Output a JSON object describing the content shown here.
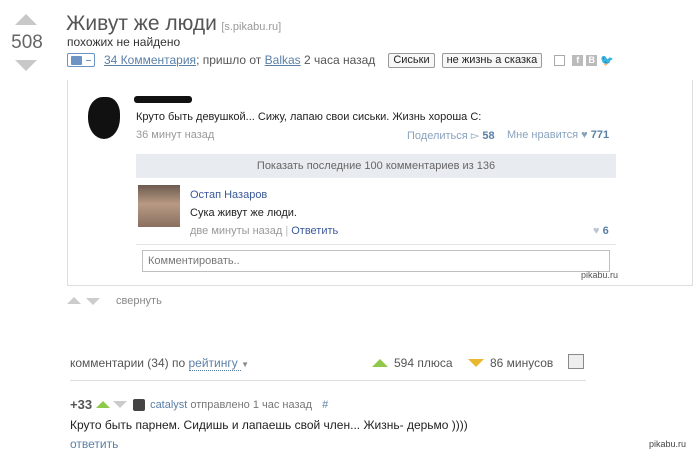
{
  "post": {
    "rating": "508",
    "title": "Живут же люди",
    "source": "[s.pikabu.ru]",
    "subtitle": "похожих не найдено",
    "comments_link": "34 Комментария",
    "meta_text": "; пришло от",
    "author": "Balkas",
    "time": "2 часа назад",
    "tags": [
      "Сиськи",
      "не жизнь а сказка"
    ]
  },
  "screenshot": {
    "post_text": "Круто быть девушкой... Сижу, лапаю свои сиськи. Жизнь хороша С:",
    "post_time": "36 минут назад",
    "share_label": "Поделиться",
    "share_count": "58",
    "like_label": "Мне нравится",
    "like_count": "771",
    "show_comments": "Показать последние 100 комментариев из 136",
    "comment_author": "Остап Назаров",
    "comment_text": "Сука живут же люди.",
    "comment_time": "две минуты назад",
    "reply_label": "Ответить",
    "comment_likes": "6",
    "comment_placeholder": "Комментировать..",
    "watermark": "pikabu.ru"
  },
  "collapse_label": "свернуть",
  "comments_bar": {
    "label": "комментарии (34) по",
    "sort": "рейтингу",
    "plus_label": "594 плюса",
    "minus_label": "86 минусов"
  },
  "comment": {
    "rating": "+33",
    "author": "catalyst",
    "time_text": "отправлено 1 час назад",
    "hash": "#",
    "text": "Круто быть парнем. Сидишь и лапаешь свой член... Жизнь- дерьмо ))))",
    "reply": "ответить"
  },
  "footer_watermark": "pikabu.ru",
  "colors": {
    "link": "#5a7fa6",
    "plus": "#8fc94a",
    "minus": "#e8b830",
    "gray_arrow": "#c8c8c8"
  }
}
